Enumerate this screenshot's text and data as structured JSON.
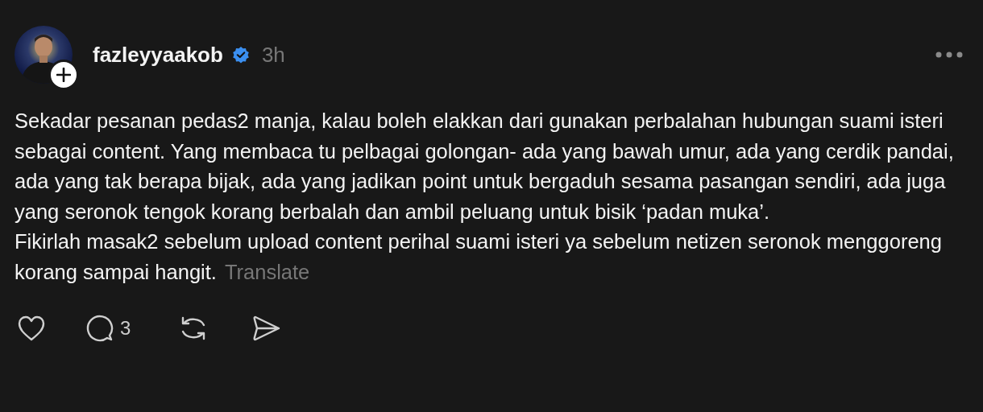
{
  "post": {
    "author": "fazleyyaakob",
    "verified": true,
    "time": "3h",
    "paragraphs": [
      "Sekadar pesanan pedas2 manja, kalau boleh elakkan dari gunakan perbalahan hubungan suami isteri sebagai content. Yang membaca tu pelbagai golongan- ada yang bawah umur, ada yang cerdik pandai, ada yang tak berapa bijak, ada yang jadikan point untuk bergaduh sesama pasangan sendiri, ada juga yang seronok tengok korang berbalah dan ambil peluang untuk bisik ‘padan muka’.",
      "Fikirlah masak2 sebelum upload content perihal suami isteri ya sebelum netizen seronok menggoreng korang sampai hangit."
    ],
    "translate": "Translate",
    "actions": [
      {
        "kind": "like"
      },
      {
        "kind": "comment",
        "count": "3"
      },
      {
        "kind": "repost"
      },
      {
        "kind": "share"
      }
    ]
  }
}
